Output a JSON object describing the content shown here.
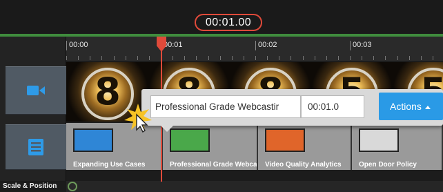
{
  "header": {
    "current_time": "00:01.00"
  },
  "ruler": {
    "labels": [
      "00:00",
      "00:01",
      "00:02",
      "00:03"
    ]
  },
  "tracks": {
    "video_icon": "video-camera-icon",
    "slides_icon": "slides-list-icon",
    "scale_label": "Scale & Position"
  },
  "countdown_frames": [
    "8",
    "8",
    "8",
    "5",
    "5"
  ],
  "slides": [
    {
      "caption": "Expanding Use Cases",
      "thumb_color": "#2f86d6"
    },
    {
      "caption": "Professional Grade Webca",
      "thumb_color": "#4aa84a"
    },
    {
      "caption": "Video Quality Analytics",
      "thumb_color": "#e0652a"
    },
    {
      "caption": "Open Door Policy",
      "thumb_color": "#d9d9d9"
    }
  ],
  "popup": {
    "title_value": "Professional Grade Webcastir",
    "time_value": "00:01.0",
    "actions_label": "Actions"
  },
  "colors": {
    "accent": "#2a9ae6",
    "playhead": "#e04a3a",
    "progress_line": "#3f8c3d"
  }
}
